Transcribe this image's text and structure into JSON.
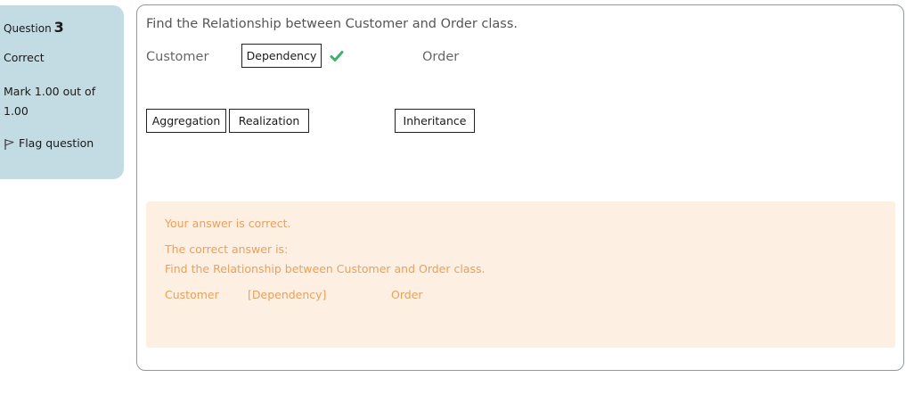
{
  "info": {
    "question_label": "Question",
    "question_number": "3",
    "state": "Correct",
    "grade": "Mark 1.00 out of 1.00",
    "flag_label": "Flag question"
  },
  "question": {
    "text": "Find the Relationship between Customer and Order class.",
    "left_word": "Customer",
    "right_word": "Order",
    "dropped_answer": "Dependency",
    "choices": [
      "Aggregation",
      "Realization",
      "Inheritance"
    ]
  },
  "feedback": {
    "general": "Your answer is correct.",
    "right_answer_label": "The correct answer is:",
    "right_answer_question": "Find the Relationship between Customer and Order class.",
    "right_answer_left": "Customer",
    "right_answer_fill": "[Dependency]",
    "right_answer_right": "Order"
  },
  "colors": {
    "info_bg": "#c3dbe3",
    "feedback_bg": "#fdefe1",
    "feedback_text": "#e8a15e",
    "check": "#3eb26c"
  }
}
